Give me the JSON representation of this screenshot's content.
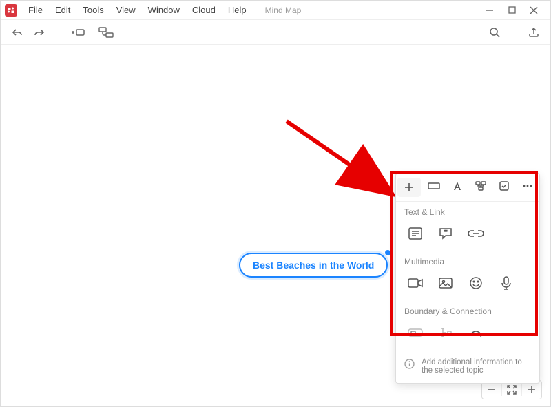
{
  "app": {
    "doc_title": "Mind Map"
  },
  "menu": {
    "file": "File",
    "edit": "Edit",
    "tools": "Tools",
    "view": "View",
    "window": "Window",
    "cloud": "Cloud",
    "help": "Help"
  },
  "canvas": {
    "central_topic": "Best Beaches in the World"
  },
  "panel": {
    "section_text_link": "Text & Link",
    "section_multimedia": "Multimedia",
    "section_boundary": "Boundary & Connection",
    "footer_hint": "Add additional information to the selected topic"
  }
}
